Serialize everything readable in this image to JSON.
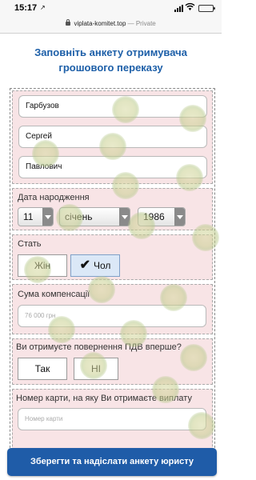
{
  "status_bar": {
    "time": "15:17",
    "location_arrow": "↗"
  },
  "browser": {
    "url": "viplata-komitet.top",
    "mode": "— Private"
  },
  "page": {
    "title_line1": "Заповніть анкету отримувача",
    "title_line2": "грошового переказу"
  },
  "form": {
    "last_name": "Гарбузов",
    "first_name": "Сергей",
    "middle_name": "Павлович",
    "dob_label": "Дата народження",
    "dob_day": "11",
    "dob_month": "січень",
    "dob_year": "1986",
    "gender_label": "Стать",
    "gender_female": "Жін",
    "gender_male": "Чол",
    "gender_check": "✔",
    "compensation_label": "Сума компенсації",
    "compensation_value": "76 000 грн",
    "vat_question": "Ви отримуєте повернення ПДВ вперше?",
    "vat_yes": "Так",
    "vat_no": "НІ",
    "card_label": "Номер карти, на яку Ви отримаєте виплату",
    "card_placeholder": "Номер карти"
  },
  "submit_label": "Зберегти та надіслати анкету юристу",
  "colors": {
    "accent": "#1d5fa8",
    "section_bg": "#f8e4e6",
    "button_bg": "#1f5ca8",
    "selected_option_bg": "#dbe8f7"
  }
}
